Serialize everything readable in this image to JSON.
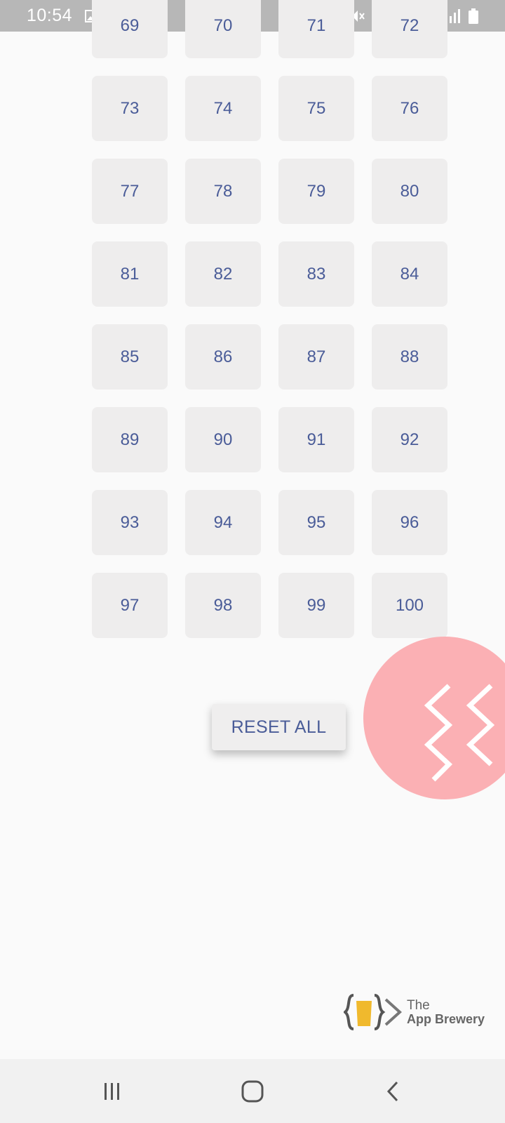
{
  "status_bar": {
    "time": "10:54",
    "left_icons": [
      "image-icon",
      "linkedin-icon",
      "dnd-icon"
    ],
    "right_icons": [
      "mute-icon",
      "hotspot-icon",
      "4g-icon",
      "signal-icon",
      "signal-icon-2",
      "battery-icon"
    ]
  },
  "grid": {
    "rows": [
      [
        "69",
        "70",
        "71",
        "72"
      ],
      [
        "73",
        "74",
        "75",
        "76"
      ],
      [
        "77",
        "78",
        "79",
        "80"
      ],
      [
        "81",
        "82",
        "83",
        "84"
      ],
      [
        "85",
        "86",
        "87",
        "88"
      ],
      [
        "89",
        "90",
        "91",
        "92"
      ],
      [
        "93",
        "94",
        "95",
        "96"
      ],
      [
        "97",
        "98",
        "99",
        "100"
      ]
    ]
  },
  "reset_button": {
    "label": "RESET ALL"
  },
  "logo": {
    "line1": "The",
    "line2": "App Brewery"
  },
  "nav_bar": {
    "items": [
      "recent-apps-icon",
      "home-icon",
      "back-icon"
    ]
  },
  "colors": {
    "accent_text": "#4a5c98",
    "cell_bg": "#eeeded",
    "pink": "#fbb0b4",
    "status_bar": "#b7b7b7"
  }
}
